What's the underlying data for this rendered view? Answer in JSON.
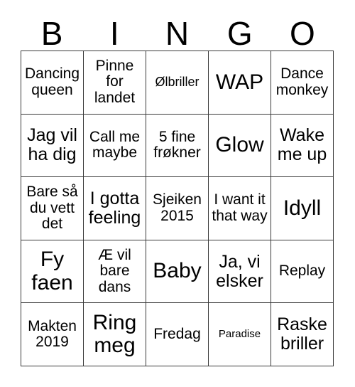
{
  "card": {
    "header_letters": [
      "B",
      "I",
      "N",
      "G",
      "O"
    ],
    "colors": {
      "background": "#ffffff",
      "text": "#000000",
      "border": "#3a3a3a"
    },
    "rows": [
      [
        {
          "label": "Dancing queen",
          "size": "md"
        },
        {
          "label": "Pinne for landet",
          "size": "md"
        },
        {
          "label": "Ølbriller",
          "size": "sm"
        },
        {
          "label": "WAP",
          "size": "xl"
        },
        {
          "label": "Dance monkey",
          "size": "md"
        }
      ],
      [
        {
          "label": "Jag vil ha dig",
          "size": "lg"
        },
        {
          "label": "Call me maybe",
          "size": "md"
        },
        {
          "label": "5 fine frøkner",
          "size": "md"
        },
        {
          "label": "Glow",
          "size": "xl"
        },
        {
          "label": "Wake me up",
          "size": "lg"
        }
      ],
      [
        {
          "label": "Bare så du vett det",
          "size": "md"
        },
        {
          "label": "I gotta feeling",
          "size": "lg"
        },
        {
          "label": "Sjeiken 2015",
          "size": "md"
        },
        {
          "label": "I want it that way",
          "size": "md"
        },
        {
          "label": "Idyll",
          "size": "xl"
        }
      ],
      [
        {
          "label": "Fy faen",
          "size": "xl"
        },
        {
          "label": "Æ vil bare dans",
          "size": "md"
        },
        {
          "label": "Baby",
          "size": "xl"
        },
        {
          "label": "Ja, vi elsker",
          "size": "lg"
        },
        {
          "label": "Replay",
          "size": "md"
        }
      ],
      [
        {
          "label": "Makten 2019",
          "size": "md"
        },
        {
          "label": "Ring meg",
          "size": "xl"
        },
        {
          "label": "Fredag",
          "size": "md"
        },
        {
          "label": "Paradise",
          "size": "xs"
        },
        {
          "label": "Raske briller",
          "size": "lg"
        }
      ]
    ]
  }
}
